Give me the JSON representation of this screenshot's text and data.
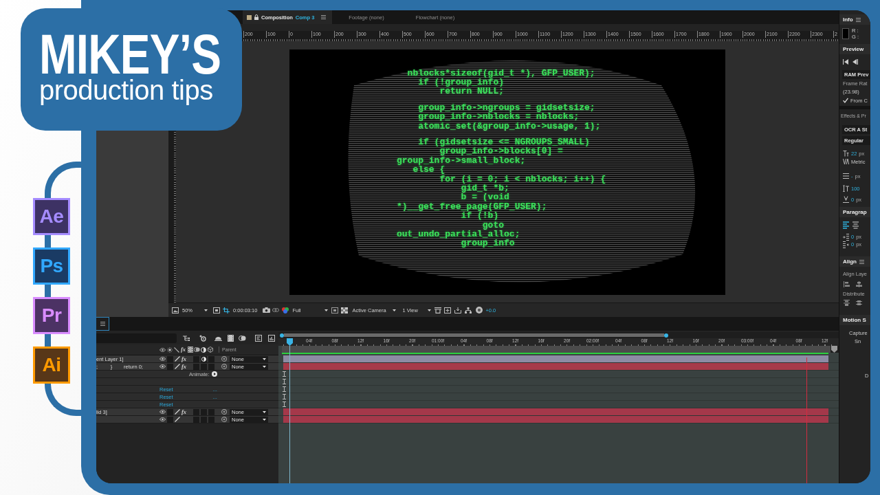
{
  "badge": {
    "title": "MIKEY’S",
    "subtitle": "production tips"
  },
  "apps": [
    {
      "label": "Ae",
      "color": "#a58cff"
    },
    {
      "label": "Ps",
      "color": "#31a8ff"
    },
    {
      "label": "Pr",
      "color": "#d98cff"
    },
    {
      "label": "Ai",
      "color": "#ff9a00"
    }
  ],
  "composition_panel": {
    "tabs": [
      {
        "kind": "composition",
        "label": "Composition",
        "comp_name": "Comp 3",
        "selected": true
      },
      {
        "kind": "panel",
        "label": "Footage (none)",
        "selected": false
      },
      {
        "kind": "panel",
        "label": "Flowchart (none)",
        "selected": false
      }
    ],
    "ruler_labels": [
      "200",
      "100",
      "0",
      "100",
      "200",
      "300",
      "400",
      "500",
      "600",
      "700",
      "800",
      "900",
      "1000",
      "1100",
      "1200",
      "1300",
      "1400",
      "1500",
      "1600",
      "1700",
      "1800",
      "1900",
      "2000",
      "2100",
      "2200",
      "2300",
      "2"
    ],
    "viewer": {
      "code_blocks": [
        {
          "lines": [
            "  nblocks*sizeof(gid_t *), GFP_USER);",
            "    if (!group_info)",
            "        return NULL;"
          ]
        },
        {
          "lines": [
            "    group_info->ngroups = gidsetsize;",
            "    group_info->nblocks = nblocks;",
            "    atomic_set(&group_info->usage, 1);"
          ]
        },
        {
          "lines": [
            "    if (gidsetsize <= NGROUPS_SMALL)",
            "        group_info->blocks[0] =",
            "group_info->small_block;",
            "   else {",
            "        for (i = 0; i < nblocks; i++) {",
            "            gid_t *b;",
            "            b = (void",
            "*)__get_free_page(GFP_USER);",
            "            if (!b)",
            "                goto",
            "out_undo_partial_alloc;",
            "            group_info"
          ]
        }
      ]
    },
    "toolbar": {
      "zoom": "50%",
      "timecode": "0:00:03:10",
      "resolution": "Full",
      "camera": "Active Camera",
      "views": "1 View",
      "exposure": "+0.0"
    }
  },
  "timeline": {
    "header": {
      "effects": "fx",
      "parent": "Parent"
    },
    "layers": [
      {
        "name": "ent Layer 1]",
        "color": "#8d8ba4",
        "effects_switch": {
          "label": "fx",
          "on": true
        },
        "adjustment": true,
        "parent": "None"
      },
      {
        "name": ";         }        return 0;",
        "color": "#a63a4a",
        "effects_switch": {
          "label": "fx",
          "on": true
        },
        "adjustment": false,
        "parent": "None",
        "children": [
          {
            "kind": "animate",
            "text": "Animate:"
          },
          {
            "kind": "empty"
          },
          {
            "kind": "reset",
            "link": "Reset",
            "ellipsis": "..."
          },
          {
            "kind": "reset",
            "link": "Reset",
            "ellipsis": "..."
          },
          {
            "kind": "reset",
            "link": "Reset"
          }
        ]
      },
      {
        "name": "lid 3]",
        "color": "#a4384a",
        "effects_switch": {
          "label": "fx",
          "on": true
        },
        "adjustment": false,
        "parent": "None"
      },
      {
        "color": "#a4384a",
        "adjustment": false,
        "parent": "None"
      }
    ],
    "ruler_labels": [
      "04f",
      "08f",
      "12f",
      "16f",
      "20f",
      "01:00f",
      "04f",
      "08f",
      "12f",
      "16f",
      "20f",
      "02:00f",
      "04f",
      "08f",
      "12f",
      "16f",
      "20f",
      "03:00f",
      "04f",
      "08f",
      "12f"
    ]
  },
  "right_panel": {
    "info": {
      "title": "Info",
      "readouts": [
        "R :",
        "G :"
      ]
    },
    "preview": {
      "title": "Preview",
      "mode": "RAM Prev",
      "frame_rate_label": "Frame Rat",
      "frame_rate": "(23.98)",
      "from_current": {
        "label": "From C",
        "checked": true
      }
    },
    "effects_title": "Effects & Pr",
    "character": {
      "font": "OCR A St",
      "style": "Regular",
      "fields": [
        {
          "kind": "size",
          "value": "22",
          "unit": "px"
        },
        {
          "kind": "kerning",
          "value": "Metric"
        },
        {
          "kind": "leading",
          "value": "-",
          "unit": "px"
        },
        {
          "kind": "scale",
          "value": "100"
        },
        {
          "kind": "baseline",
          "value": "0",
          "unit": "px"
        }
      ]
    },
    "paragraph": {
      "title": "Paragrap",
      "alignments": [
        {
          "kind": "left",
          "selected": true
        },
        {
          "kind": "center",
          "selected": false
        }
      ],
      "fields": [
        {
          "kind": "indent_left",
          "value": "0",
          "unit": "px"
        },
        {
          "kind": "indent_right",
          "value": "0",
          "unit": "px"
        }
      ]
    },
    "align": {
      "title": "Align",
      "align_label": "Align Laye",
      "distribute_label": "Distribute"
    },
    "motion": {
      "title": "Motion S",
      "labels": [
        "Capture",
        "Sn",
        "D"
      ]
    }
  }
}
